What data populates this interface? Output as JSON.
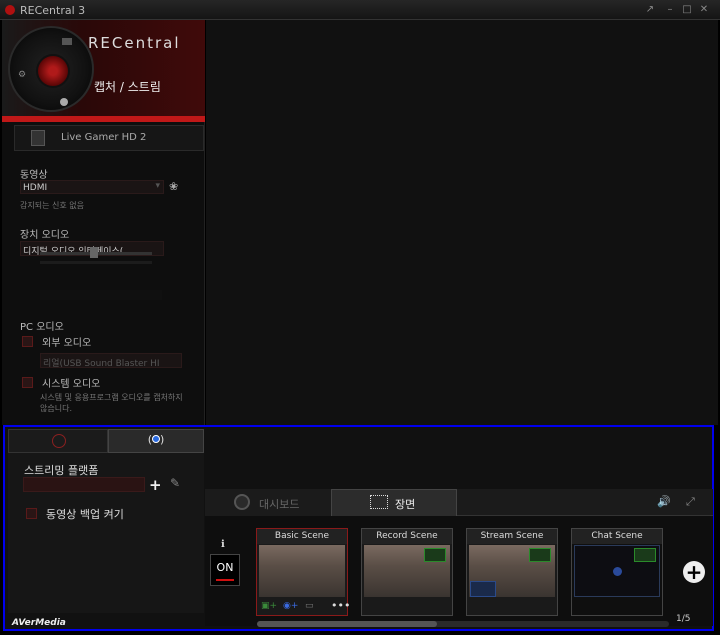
{
  "window": {
    "title": "RECentral 3"
  },
  "brand": {
    "name": "RECentral",
    "mode": "캡처 / 스트림"
  },
  "device": {
    "name": "Live Gamer HD 2"
  },
  "video": {
    "label": "동영상",
    "source": "HDMI",
    "status": "감지되는 신호 없음"
  },
  "device_audio": {
    "label": "장치 오디오",
    "source": "디지털 오디오 인터페이스(",
    "level_percent": 50
  },
  "pc_audio": {
    "label": "PC 오디오",
    "external_label": "외부 오디오",
    "external_device": "리얼(USB Sound Blaster HI",
    "system_label": "시스템 오디오",
    "system_note": "시스템 및 응용프로그램 오디오를 캡처하지 않습니다."
  },
  "stream": {
    "platform_label": "스트리밍 플랫폼",
    "platform_value": "",
    "backup_label": "동영상 백업 켜기"
  },
  "tabs": {
    "dashboard": "대시보드",
    "scene": "장면"
  },
  "on_button": "ON",
  "scenes": [
    {
      "title": "Basic Scene"
    },
    {
      "title": "Record Scene"
    },
    {
      "title": "Stream Scene"
    },
    {
      "title": "Chat Scene"
    }
  ],
  "pager": "1/5",
  "footer_brand": "AVerMedia",
  "colors": {
    "accent": "#c01818",
    "frame": "#0000ee"
  }
}
